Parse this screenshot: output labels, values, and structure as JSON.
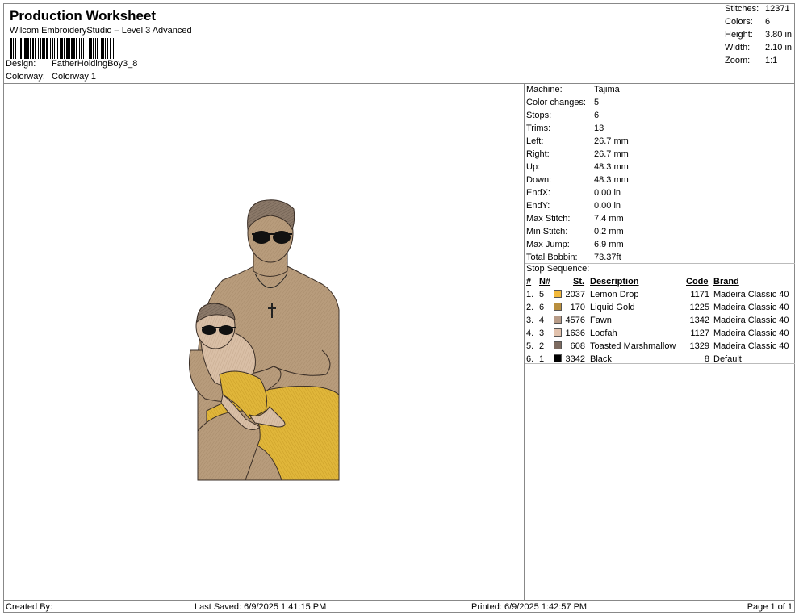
{
  "header": {
    "title": "Production Worksheet",
    "software": "Wilcom EmbroideryStudio – Level 3 Advanced",
    "design_label": "Design:",
    "design_value": "FatherHoldingBoy3_8",
    "colorway_label": "Colorway:",
    "colorway_value": "Colorway 1"
  },
  "summary": [
    {
      "label": "Stitches:",
      "value": "12371"
    },
    {
      "label": "Colors:",
      "value": "6"
    },
    {
      "label": "Height:",
      "value": "3.80 in"
    },
    {
      "label": "Width:",
      "value": "2.10 in"
    },
    {
      "label": "Zoom:",
      "value": "1:1"
    }
  ],
  "machine_info": [
    {
      "label": "Machine:",
      "value": "Tajima"
    },
    {
      "label": "Color changes:",
      "value": "5"
    },
    {
      "label": "Stops:",
      "value": "6"
    },
    {
      "label": "Trims:",
      "value": "13"
    },
    {
      "label": "Left:",
      "value": "26.7 mm"
    },
    {
      "label": "Right:",
      "value": "26.7 mm"
    },
    {
      "label": "Up:",
      "value": "48.3 mm"
    },
    {
      "label": "Down:",
      "value": "48.3 mm"
    },
    {
      "label": "EndX:",
      "value": "0.00 in"
    },
    {
      "label": "EndY:",
      "value": "0.00 in"
    },
    {
      "label": "Max Stitch:",
      "value": "7.4 mm"
    },
    {
      "label": "Min Stitch:",
      "value": "0.2 mm"
    },
    {
      "label": "Max Jump:",
      "value": "6.9 mm"
    },
    {
      "label": "Total Bobbin:",
      "value": "73.37ft"
    }
  ],
  "stop_sequence": {
    "label": "Stop Sequence:",
    "columns": {
      "num": "#",
      "n": "N#",
      "st": "St.",
      "description": "Description",
      "code": "Code",
      "brand": "Brand"
    },
    "rows": [
      {
        "num": "1.",
        "n": "5",
        "color": "#f2b93b",
        "st": "2037",
        "description": "Lemon Drop",
        "code": "1171",
        "brand": "Madeira Classic 40"
      },
      {
        "num": "2.",
        "n": "6",
        "color": "#b98f3e",
        "st": "170",
        "description": "Liquid Gold",
        "code": "1225",
        "brand": "Madeira Classic 40"
      },
      {
        "num": "3.",
        "n": "4",
        "color": "#b89c88",
        "st": "4576",
        "description": "Fawn",
        "code": "1342",
        "brand": "Madeira Classic 40"
      },
      {
        "num": "4.",
        "n": "3",
        "color": "#e2c2ad",
        "st": "1636",
        "description": "Loofah",
        "code": "1127",
        "brand": "Madeira Classic 40"
      },
      {
        "num": "5.",
        "n": "2",
        "color": "#7d6b60",
        "st": "608",
        "description": "Toasted Marshmallow",
        "code": "1329",
        "brand": "Madeira Classic 40"
      },
      {
        "num": "6.",
        "n": "1",
        "color": "#000000",
        "st": "3342",
        "description": "Black",
        "code": "8",
        "brand": "Default"
      }
    ]
  },
  "footer": {
    "created_by": "Created By:",
    "last_saved": "Last Saved: 6/9/2025 1:41:15 PM",
    "printed": "Printed: 6/9/2025 1:42:57 PM",
    "page": "Page 1 of 1"
  }
}
